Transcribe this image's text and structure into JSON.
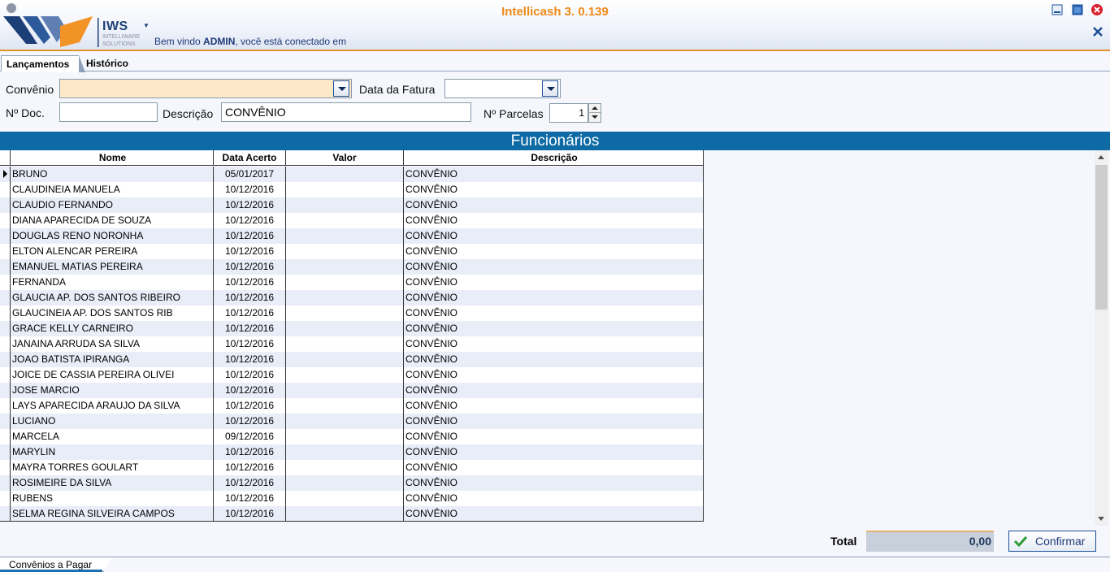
{
  "header": {
    "app_title": "Intellicash 3. 0.139",
    "logo_text": "IWS",
    "logo_sub1": "INTELLIWARE",
    "logo_sub2": "SOLUTIONS",
    "welcome_prefix": "Bem vindo ",
    "welcome_user": "ADMIN",
    "welcome_suffix": ", você está conectado em"
  },
  "tabs": [
    {
      "label": "Lançamentos",
      "active": true
    },
    {
      "label": "Histórico",
      "active": false
    }
  ],
  "form": {
    "convenio_label": "Convênio",
    "convenio_value": "",
    "data_fatura_label": "Data da Fatura",
    "data_fatura_value": "",
    "ndoc_label": "Nº Doc.",
    "ndoc_value": "",
    "descricao_label": "Descrição",
    "descricao_value": "CONVÊNIO",
    "nparcelas_label": "Nº Parcelas",
    "nparcelas_value": "1"
  },
  "section_title": "Funcionários",
  "grid": {
    "columns": [
      "Nome",
      "Data Acerto",
      "Valor",
      "Descrição"
    ],
    "rows": [
      {
        "nome": "BRUNO",
        "data": "05/01/2017",
        "valor": "",
        "desc": "CONVÊNIO"
      },
      {
        "nome": "CLAUDINEIA MANUELA",
        "data": "10/12/2016",
        "valor": "",
        "desc": "CONVÊNIO"
      },
      {
        "nome": "CLAUDIO FERNANDO",
        "data": "10/12/2016",
        "valor": "",
        "desc": "CONVÊNIO"
      },
      {
        "nome": "DIANA APARECIDA DE SOUZA",
        "data": "10/12/2016",
        "valor": "",
        "desc": "CONVÊNIO"
      },
      {
        "nome": "DOUGLAS RENO NORONHA",
        "data": "10/12/2016",
        "valor": "",
        "desc": "CONVÊNIO"
      },
      {
        "nome": "ELTON ALENCAR PEREIRA",
        "data": "10/12/2016",
        "valor": "",
        "desc": "CONVÊNIO"
      },
      {
        "nome": "EMANUEL MATIAS PEREIRA",
        "data": "10/12/2016",
        "valor": "",
        "desc": "CONVÊNIO"
      },
      {
        "nome": "FERNANDA",
        "data": "10/12/2016",
        "valor": "",
        "desc": "CONVÊNIO"
      },
      {
        "nome": "GLAUCIA AP. DOS SANTOS RIBEIRO",
        "data": "10/12/2016",
        "valor": "",
        "desc": "CONVÊNIO"
      },
      {
        "nome": "GLAUCINEIA AP. DOS SANTOS RIB",
        "data": "10/12/2016",
        "valor": "",
        "desc": "CONVÊNIO"
      },
      {
        "nome": "GRACE KELLY CARNEIRO",
        "data": "10/12/2016",
        "valor": "",
        "desc": "CONVÊNIO"
      },
      {
        "nome": "JANAINA ARRUDA SA SILVA",
        "data": "10/12/2016",
        "valor": "",
        "desc": "CONVÊNIO"
      },
      {
        "nome": "JOAO BATISTA IPIRANGA",
        "data": "10/12/2016",
        "valor": "",
        "desc": "CONVÊNIO"
      },
      {
        "nome": "JOICE DE CASSIA PEREIRA OLIVEI",
        "data": "10/12/2016",
        "valor": "",
        "desc": "CONVÊNIO"
      },
      {
        "nome": "JOSE MARCIO",
        "data": "10/12/2016",
        "valor": "",
        "desc": "CONVÊNIO"
      },
      {
        "nome": "LAYS APARECIDA ARAUJO DA SILVA",
        "data": "10/12/2016",
        "valor": "",
        "desc": "CONVÊNIO"
      },
      {
        "nome": "LUCIANO",
        "data": "10/12/2016",
        "valor": "",
        "desc": "CONVÊNIO"
      },
      {
        "nome": "MARCELA",
        "data": "09/12/2016",
        "valor": "",
        "desc": "CONVÊNIO"
      },
      {
        "nome": "MARYLIN",
        "data": "10/12/2016",
        "valor": "",
        "desc": "CONVÊNIO"
      },
      {
        "nome": "MAYRA TORRES GOULART",
        "data": "10/12/2016",
        "valor": "",
        "desc": "CONVÊNIO"
      },
      {
        "nome": "ROSIMEIRE DA SILVA",
        "data": "10/12/2016",
        "valor": "",
        "desc": "CONVÊNIO"
      },
      {
        "nome": "RUBENS",
        "data": "10/12/2016",
        "valor": "",
        "desc": "CONVÊNIO"
      },
      {
        "nome": "SELMA REGINA SILVEIRA CAMPOS",
        "data": "10/12/2016",
        "valor": "",
        "desc": "CONVÊNIO"
      }
    ]
  },
  "footer": {
    "total_label": "Total",
    "total_value": "0,00",
    "confirm_label": "Confirmar",
    "bottom_tab": "Convênios a Pagar"
  },
  "colors": {
    "accent_orange": "#ee8a17",
    "section_blue": "#0e6aa5",
    "text_navy": "#1e3a78",
    "row_alt": "#e8edf8",
    "input_highlight": "#fde9c8"
  }
}
